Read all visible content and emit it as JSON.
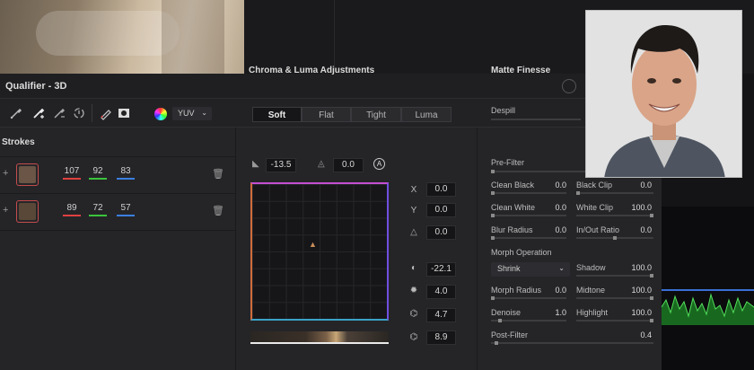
{
  "panel": {
    "title": "Qualifier - 3D"
  },
  "toolbar": {
    "color_space": "YUV",
    "modes": [
      "Soft",
      "Flat",
      "Tight",
      "Luma"
    ],
    "active_mode": "Soft",
    "despill_label": "Despill",
    "icons": [
      "eyedropper-icon",
      "eyedropper-add-icon",
      "eyedropper-subtract-icon",
      "color-cycle-icon",
      "pen-stroke-icon",
      "matte-toggle-icon",
      "color-wheel-icon"
    ]
  },
  "strokes": {
    "heading": "Strokes",
    "rows": [
      {
        "color": "#6a5546",
        "values": [
          "107",
          "92",
          "83"
        ]
      },
      {
        "color": "#594838",
        "values": [
          "89",
          "72",
          "57"
        ]
      }
    ],
    "channel_colors": [
      "#e04040",
      "#3bc43b",
      "#3b7fe0"
    ]
  },
  "chroma": {
    "heading": "Chroma & Luma Adjustments",
    "angle_value": "-13.5",
    "softness_value": "0.0",
    "axes": [
      {
        "label": "X",
        "value": "0.0"
      },
      {
        "label": "Y",
        "value": "0.0"
      },
      {
        "label": "",
        "value": "0.0",
        "icon": "triangle-icon"
      },
      {
        "label": "",
        "value": "-22.1",
        "icon": "contrast-icon"
      },
      {
        "label": "",
        "value": "4.0",
        "icon": "brightness-icon"
      },
      {
        "label": "",
        "value": "4.7",
        "icon": "feather-icon"
      },
      {
        "label": "",
        "value": "8.9",
        "icon": "feather-alt-icon"
      }
    ]
  },
  "matte": {
    "heading": "Matte Finesse",
    "pre_filter": "Pre-Filter",
    "left_fields": [
      {
        "label": "Clean Black",
        "value": "0.0"
      },
      {
        "label": "Clean White",
        "value": "0.0"
      },
      {
        "label": "Blur Radius",
        "value": "0.0"
      }
    ],
    "right_fields": [
      {
        "label": "Black Clip",
        "value": "0.0"
      },
      {
        "label": "White Clip",
        "value": "100.0"
      },
      {
        "label": "In/Out Ratio",
        "value": "0.0"
      }
    ],
    "morph_operation_label": "Morph Operation",
    "morph_operation_value": "Shrink",
    "left_fields2": [
      {
        "label": "Morph Radius",
        "value": "0.0"
      },
      {
        "label": "Denoise",
        "value": "1.0"
      }
    ],
    "right_fields2": [
      {
        "label": "Shadow",
        "value": "100.0"
      },
      {
        "label": "Midtone",
        "value": "100.0"
      },
      {
        "label": "Highlight",
        "value": "100.0"
      }
    ],
    "post_filter_label": "Post-Filter",
    "post_filter_value": "0.4"
  }
}
